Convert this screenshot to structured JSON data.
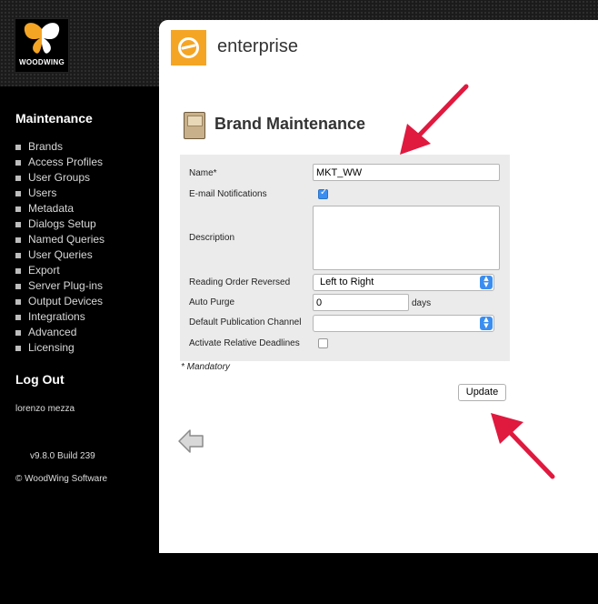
{
  "logo": {
    "text": "WOODWING"
  },
  "brand": {
    "name": "enterprise"
  },
  "sidebar": {
    "title": "Maintenance",
    "items": [
      {
        "label": "Brands"
      },
      {
        "label": "Access Profiles"
      },
      {
        "label": "User Groups"
      },
      {
        "label": "Users"
      },
      {
        "label": "Metadata"
      },
      {
        "label": "Dialogs Setup"
      },
      {
        "label": "Named Queries"
      },
      {
        "label": "User Queries"
      },
      {
        "label": "Export"
      },
      {
        "label": "Server Plug-ins"
      },
      {
        "label": "Output Devices"
      },
      {
        "label": "Integrations"
      },
      {
        "label": "Advanced"
      },
      {
        "label": "Licensing"
      }
    ],
    "logout": "Log Out",
    "user": "lorenzo mezza",
    "version": "v9.8.0 Build 239",
    "copyright": "© WoodWing Software"
  },
  "page": {
    "title": "Brand Maintenance"
  },
  "form": {
    "name_label": "Name*",
    "name_value": "MKT_WW",
    "email_label": "E-mail Notifications",
    "email_checked": true,
    "description_label": "Description",
    "description_value": "",
    "reading_order_label": "Reading Order Reversed",
    "reading_order_value": "Left to Right",
    "auto_purge_label": "Auto Purge",
    "auto_purge_value": "0",
    "auto_purge_unit": "days",
    "default_channel_label": "Default Publication Channel",
    "default_channel_value": "",
    "relative_deadlines_label": "Activate Relative Deadlines",
    "relative_deadlines_checked": false,
    "mandatory_note": "* Mandatory",
    "update_label": "Update"
  },
  "colors": {
    "accent_orange": "#f5a524",
    "arrow_red": "#e0193f",
    "checkbox_blue": "#3b8ef0"
  }
}
